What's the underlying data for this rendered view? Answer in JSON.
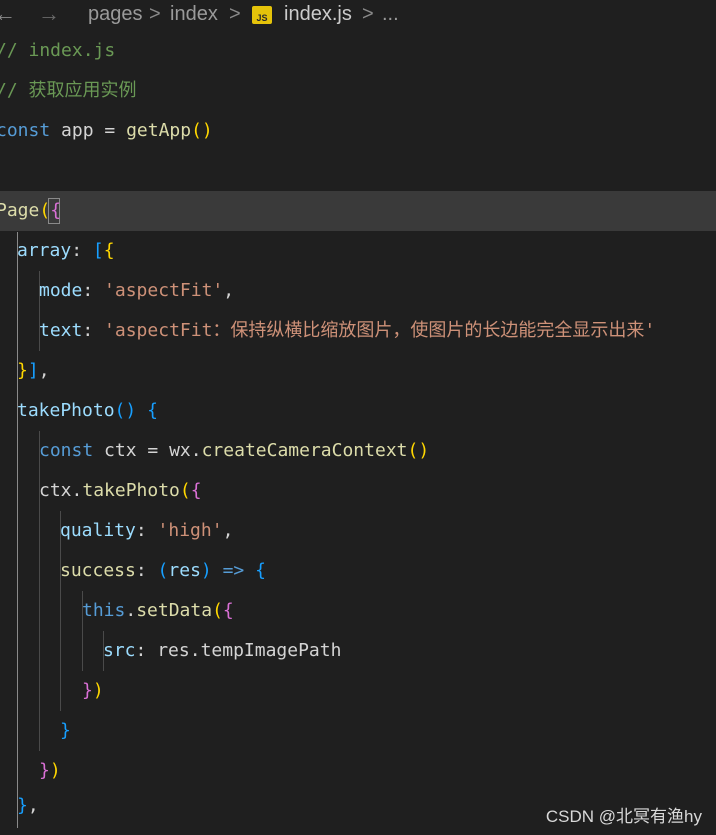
{
  "breadcrumb": {
    "back_icon": "arrow-left-icon",
    "forward_icon": "arrow-right-icon",
    "items": [
      "pages",
      "index",
      "index.js",
      "..."
    ],
    "separator": ">",
    "file_badge": "JS"
  },
  "code": {
    "line1": {
      "comment": "// index.js"
    },
    "line2": {
      "comment": "// 获取应用实例"
    },
    "line3": {
      "kw": "const",
      "name": " app ",
      "eq": "= ",
      "fn": "getApp",
      "paren": "()"
    },
    "line5": {
      "fn": "Page",
      "paren": "(",
      "brace": "{"
    },
    "line6": {
      "prop": "array",
      "colon": ": ",
      "bracket": "[",
      "brace": "{"
    },
    "line7": {
      "prop": "mode",
      "colon": ": ",
      "str": "'aspectFit'",
      "comma": ","
    },
    "line8": {
      "prop": "text",
      "colon": ": ",
      "str": "'aspectFit：保持纵横比缩放图片，使图片的长边能完全显示出来'"
    },
    "line9": {
      "brace": "}",
      "bracket": "]",
      "comma": ","
    },
    "line10": {
      "fn": "takePhoto",
      "paren": "()",
      "space": " ",
      "brace": "{"
    },
    "line11": {
      "kw": "const",
      "name": " ctx ",
      "eq": "= ",
      "obj": "wx",
      "dot": ".",
      "fn": "createCameraContext",
      "paren": "()"
    },
    "line12": {
      "obj": "ctx",
      "dot": ".",
      "fn": "takePhoto",
      "paren": "(",
      "brace": "{"
    },
    "line13": {
      "prop": "quality",
      "colon": ": ",
      "str": "'high'",
      "comma": ","
    },
    "line14": {
      "fn": "success",
      "colon": ": ",
      "paren_open": "(",
      "param": "res",
      "paren_close": ")",
      "arrow": " => ",
      "brace": "{"
    },
    "line15": {
      "kw": "this",
      "dot": ".",
      "fn": "setData",
      "paren": "(",
      "brace": "{"
    },
    "line16": {
      "prop": "src",
      "colon": ": ",
      "obj": "res",
      "dot": ".",
      "member": "tempImagePath"
    },
    "line17": {
      "brace": "}",
      "paren": ")"
    },
    "line18": {
      "brace": "}"
    },
    "line19": {
      "brace": "}",
      "paren": ")"
    },
    "line20": {
      "brace": "}",
      "comma": ","
    }
  },
  "watermark": "CSDN @北冥有渔hy"
}
